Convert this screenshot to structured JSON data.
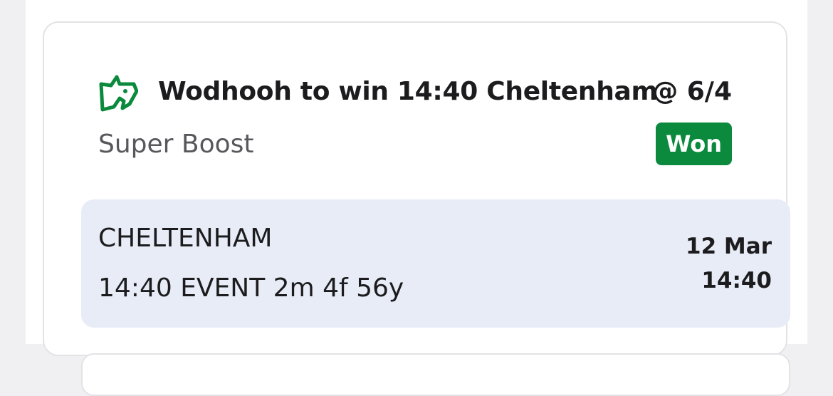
{
  "bet": {
    "icon": "horse-head-icon",
    "selection": "Wodhooh to win 14:40 Cheltenham",
    "odds": "@ 6/4",
    "bet_type": "Super Boost",
    "status": "Won"
  },
  "event": {
    "venue": "CHELTENHAM",
    "name": "14:40 EVENT 2m 4f 56y",
    "date": "12 Mar",
    "time": "14:40"
  },
  "colors": {
    "brand_green": "#0b8a3d",
    "event_panel_bg": "#e8ecf7",
    "text_primary": "#1c1c1e",
    "text_secondary": "#58585c"
  }
}
